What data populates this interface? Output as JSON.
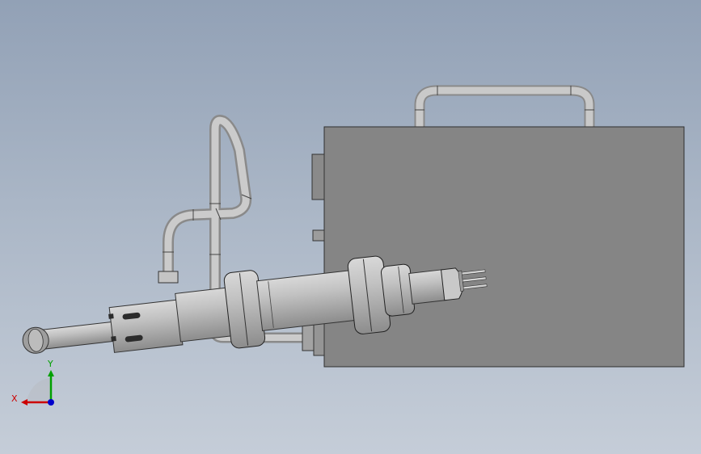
{
  "viewport": {
    "background_top": "#92a1b6",
    "background_bottom": "#c5cdd8"
  },
  "model": {
    "body_color": "#858585",
    "metal_color": "#bdbdbd",
    "accent_color": "#8b1a1a"
  },
  "triad": {
    "x_label": "X",
    "y_label": "Y",
    "x_color": "#cc0000",
    "y_color": "#00a000",
    "z_color": "#0000cc"
  }
}
